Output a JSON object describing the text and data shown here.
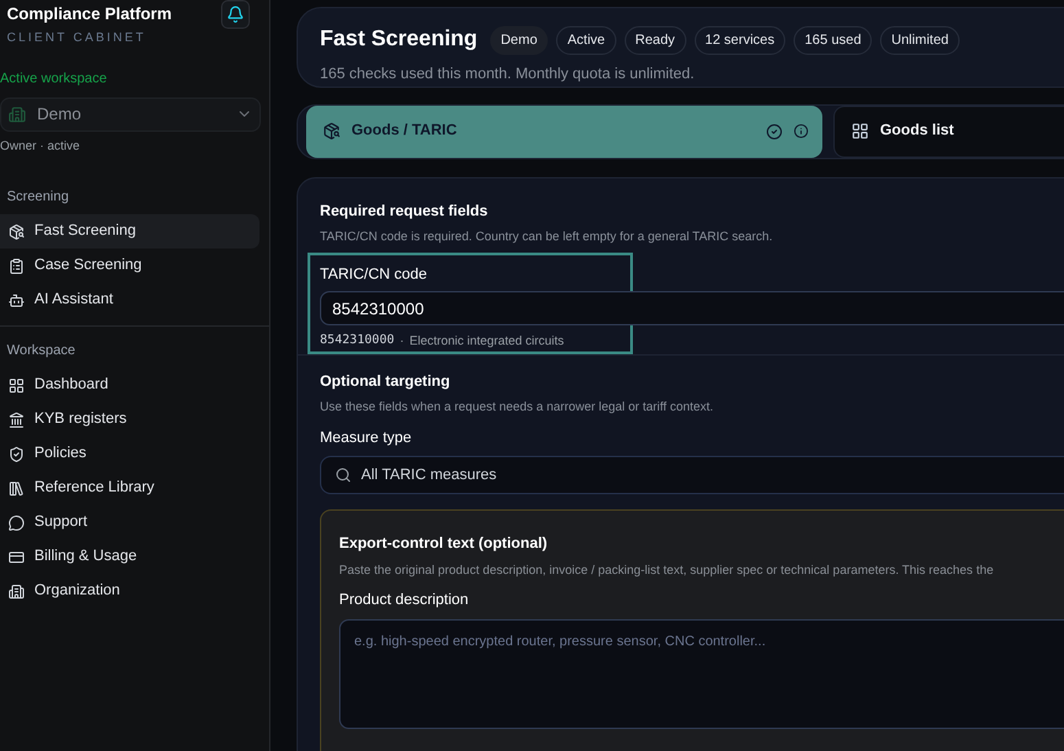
{
  "brand": {
    "title": "Compliance Platform",
    "subtitle": "CLIENT CABINET"
  },
  "workspace": {
    "label": "Active workspace",
    "name": "Demo",
    "role": "Owner · active"
  },
  "nav_sections": [
    {
      "title": "Screening",
      "items": [
        {
          "label": "Fast Screening",
          "selected": true
        },
        {
          "label": "Case Screening",
          "selected": false
        },
        {
          "label": "AI Assistant",
          "selected": false
        }
      ]
    },
    {
      "title": "Workspace",
      "items": [
        {
          "label": "Dashboard",
          "selected": false
        },
        {
          "label": "KYB registers",
          "selected": false
        },
        {
          "label": "Policies",
          "selected": false
        },
        {
          "label": "Reference Library",
          "selected": false
        },
        {
          "label": "Support",
          "selected": false
        },
        {
          "label": "Billing & Usage",
          "selected": false
        },
        {
          "label": "Organization",
          "selected": false
        }
      ]
    }
  ],
  "header": {
    "title": "Fast Screening",
    "badges": [
      "Demo",
      "Active",
      "Ready",
      "12 services",
      "165 used",
      "Unlimited"
    ],
    "subtitle": "165 checks used this month. Monthly quota is unlimited."
  },
  "tabs": [
    {
      "label": "Goods / TARIC",
      "selected": true
    },
    {
      "label": "Goods list",
      "selected": false
    }
  ],
  "required": {
    "title": "Required request fields",
    "hint": "TARIC/CN code is required. Country can be left empty for a general TARIC search.",
    "field_label": "TARIC/CN code",
    "value": "8542310000",
    "match_code": "8542310000",
    "separator": "·",
    "match_desc": "Electronic integrated circuits"
  },
  "optional": {
    "title": "Optional targeting",
    "hint": "Use these fields when a request needs a narrower legal or tariff context.",
    "measure_label": "Measure type",
    "measure_value": "All TARIC measures"
  },
  "export_control": {
    "title": "Export-control text (optional)",
    "hint": "Paste the original product description, invoice / packing-list text, supplier spec or technical parameters. This reaches the",
    "field_label": "Product description",
    "placeholder": "e.g. high-speed encrypted router, pressure sensor, CNC controller..."
  }
}
